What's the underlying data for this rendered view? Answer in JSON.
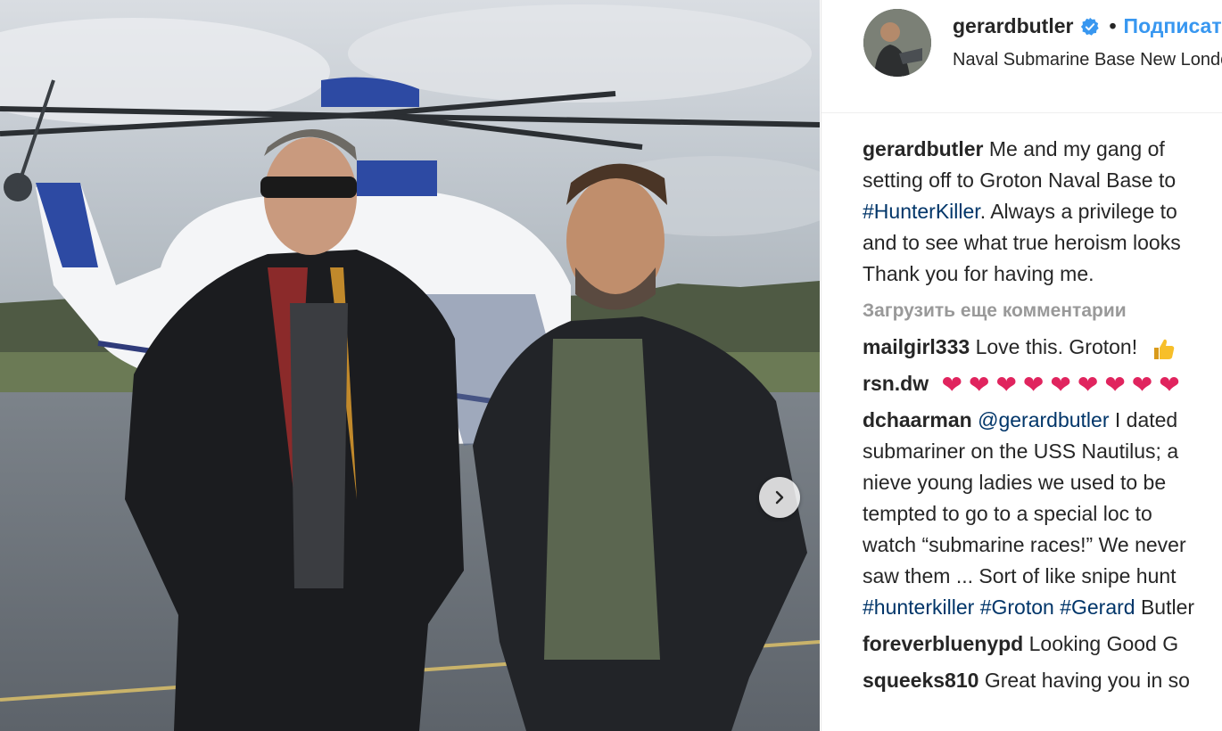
{
  "post": {
    "username": "gerardbutler",
    "follow_label": "Подписаться",
    "location": "Naval Submarine Base New London",
    "separator": "•"
  },
  "caption": {
    "username": "gerardbutler",
    "lines": [
      "Me and my gang of",
      "setting off to Groton Naval Base to",
      "#HunterKiller. Always a privilege to",
      "and to see what true heroism looks",
      "Thank you for having me."
    ]
  },
  "load_more": "Загрузить еще комментарии",
  "comments": [
    {
      "username": "mailgirl333",
      "text": "Love this. Groton!"
    },
    {
      "username": "rsn.dw",
      "text": ""
    },
    {
      "username": "dchaarman",
      "mention": "@gerardbutler",
      "first_line_rest": " I dated",
      "lines": [
        "submariner on the USS Nautilus; a",
        "nieve young ladies we used to be",
        "tempted to go to a special loc to",
        "watch “submarine races!” We never",
        "saw them ... Sort of like snipe hunt"
      ],
      "tags": [
        "#hunterkiller",
        "#Groton",
        "#Gerard"
      ],
      "tail": " Butler"
    },
    {
      "username": "foreverbluenypd",
      "text": "Looking Good G"
    },
    {
      "username": "squeeks810",
      "text": "Great having you in so"
    }
  ],
  "icons": {
    "verified": "verified-badge-icon",
    "next": "chevron-right-icon",
    "thumbs": "thumbs-up-emoji",
    "heart": "red-heart-emoji"
  },
  "colors": {
    "link": "#3897f0",
    "hashtag": "#003569",
    "muted": "#999999",
    "heart": "#e0245e"
  }
}
